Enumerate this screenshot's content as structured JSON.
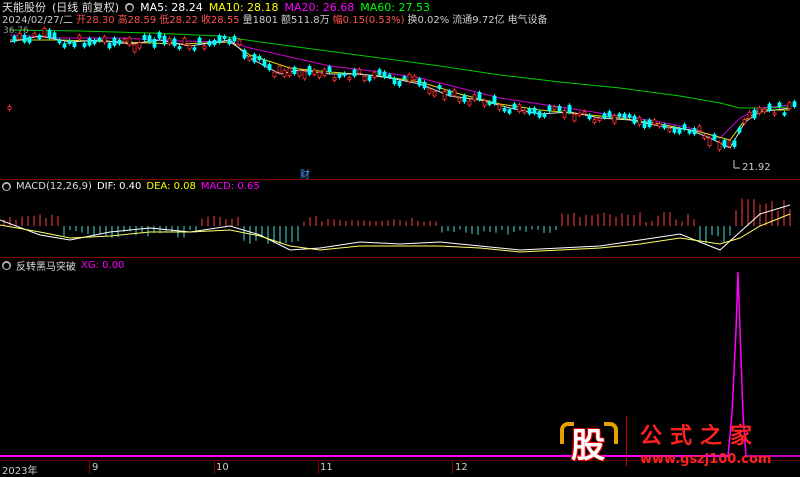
{
  "header": {
    "stock_name": "天能股份",
    "mode": "(日线 前复权)",
    "ma5_label": "MA5: 28.24",
    "ma10_label": "MA10: 28.18",
    "ma20_label": "MA20: 26.68",
    "ma60_label": "MA60: 27.53"
  },
  "info": {
    "date": "2024/02/27/二",
    "open": "开28.30",
    "high": "高28.59",
    "low": "低28.22",
    "close": "收28.55",
    "volume": "量1801",
    "amount": "额511.8万",
    "change": "幅0.15(0.53%)",
    "turnover": "换0.02%",
    "float": "流通9.72亿",
    "industry": "电气设备"
  },
  "main_chart": {
    "price_top_label": "36.76",
    "low_label": "21.92",
    "marker": "财"
  },
  "macd": {
    "title": "MACD(12,26,9)",
    "dif": "DIF: 0.40",
    "dea": "DEA: 0.08",
    "macd": "MACD: 0.65"
  },
  "indicator": {
    "title": "反转黑马突破",
    "xg": "XG: 0.00"
  },
  "axis": {
    "labels": [
      "2023年",
      "9",
      "10",
      "11",
      "12"
    ]
  },
  "watermark": {
    "logo": "股",
    "site_title": "公式之家",
    "url": "www.gszj100.com"
  },
  "colors": {
    "ma5": "#ffffff",
    "ma10": "#ffff00",
    "ma20": "#ff00ff",
    "ma60": "#00ff00",
    "up": "#ff3333",
    "down": "#00ffff",
    "xg": "#ff00ff"
  }
}
